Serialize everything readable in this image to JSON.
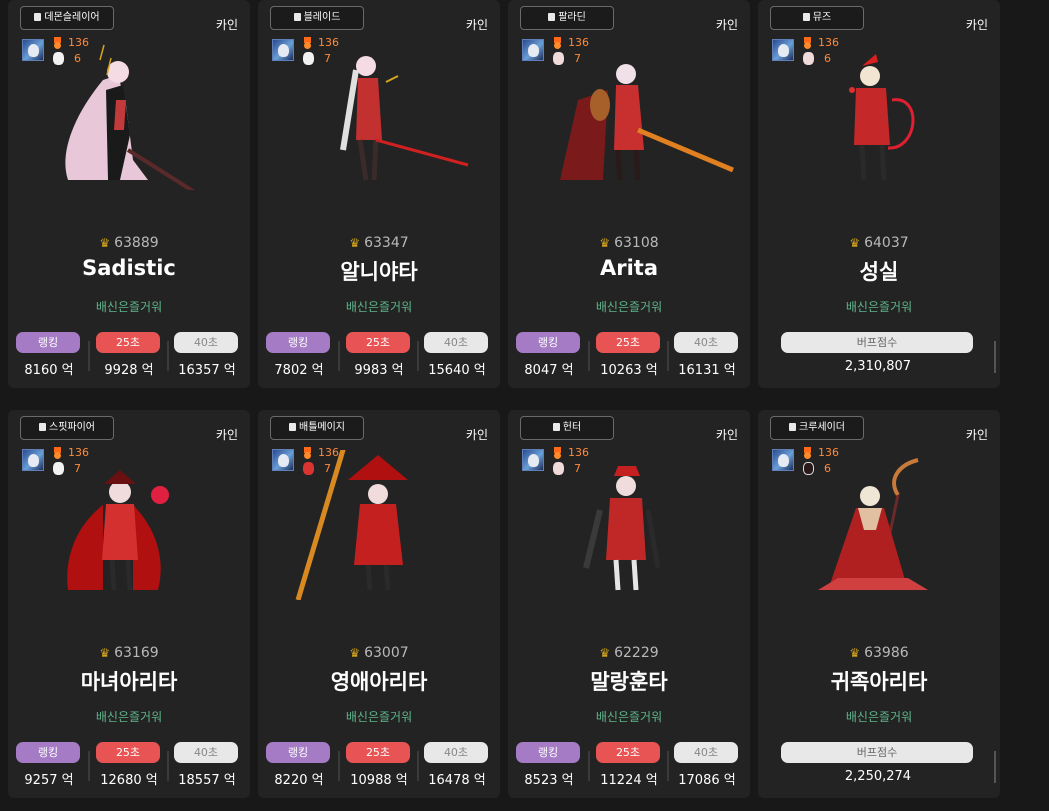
{
  "rows": [
    [
      {
        "job": "데몬슬레이어",
        "server": "카인",
        "level": "136",
        "count": "6",
        "fame": "63889",
        "name": "Sadistic",
        "guild": "배신은즐거워",
        "type": "damage",
        "labels": [
          "랭킹",
          "25초",
          "40초"
        ],
        "values": [
          "8160 억",
          "9928 억",
          "16357 억"
        ],
        "figure": "scythe"
      },
      {
        "job": "블레이드",
        "server": "카인",
        "level": "136",
        "count": "7",
        "fame": "63347",
        "name": "알니야타",
        "guild": "배신은즐거워",
        "type": "damage",
        "labels": [
          "랭킹",
          "25초",
          "40초"
        ],
        "values": [
          "7802 억",
          "9983 억",
          "15640 억"
        ],
        "figure": "blade"
      },
      {
        "job": "팔라딘",
        "server": "카인",
        "level": "136",
        "count": "7",
        "fame": "63108",
        "name": "Arita",
        "guild": "배신은즐거워",
        "type": "damage",
        "labels": [
          "랭킹",
          "25초",
          "40초"
        ],
        "values": [
          "8047 억",
          "10263 억",
          "16131 억"
        ],
        "figure": "paladin"
      },
      {
        "job": "뮤즈",
        "server": "카인",
        "level": "136",
        "count": "6",
        "fame": "64037",
        "name": "성실",
        "guild": "배신은즐거워",
        "type": "buff",
        "buff_label": "버프점수",
        "buff_value": "2,310,807",
        "figure": "muse"
      }
    ],
    [
      {
        "job": "스핏파이어",
        "server": "카인",
        "level": "136",
        "count": "7",
        "fame": "63169",
        "name": "마녀아리타",
        "guild": "배신은즐거워",
        "type": "damage",
        "labels": [
          "랭킹",
          "25초",
          "40초"
        ],
        "values": [
          "9257 억",
          "12680 억",
          "18557 억"
        ],
        "figure": "spitfire"
      },
      {
        "job": "배틀메이지",
        "server": "카인",
        "level": "136",
        "count": "7",
        "fame": "63007",
        "name": "영애아리타",
        "guild": "배신은즐거워",
        "type": "damage",
        "labels": [
          "랭킹",
          "25초",
          "40초"
        ],
        "values": [
          "8220 억",
          "10988 억",
          "16478 억"
        ],
        "figure": "mage"
      },
      {
        "job": "헌터",
        "server": "카인",
        "level": "136",
        "count": "7",
        "fame": "62229",
        "name": "말랑훈타",
        "guild": "배신은즐거워",
        "type": "damage",
        "labels": [
          "랭킹",
          "25초",
          "40초"
        ],
        "values": [
          "8523 억",
          "11224 억",
          "17086 억"
        ],
        "figure": "hunter"
      },
      {
        "job": "크루세이더",
        "server": "카인",
        "level": "136",
        "count": "6",
        "fame": "63986",
        "name": "귀족아리타",
        "guild": "배신은즐거워",
        "type": "buff",
        "buff_label": "버프점수",
        "buff_value": "2,250,274",
        "figure": "crusader"
      }
    ]
  ],
  "colors": {
    "rank": "#a47bc4",
    "s25": "#e85353",
    "s40": "#e8e8e8",
    "guild": "#5fb58c",
    "level": "#ff8a3a"
  }
}
